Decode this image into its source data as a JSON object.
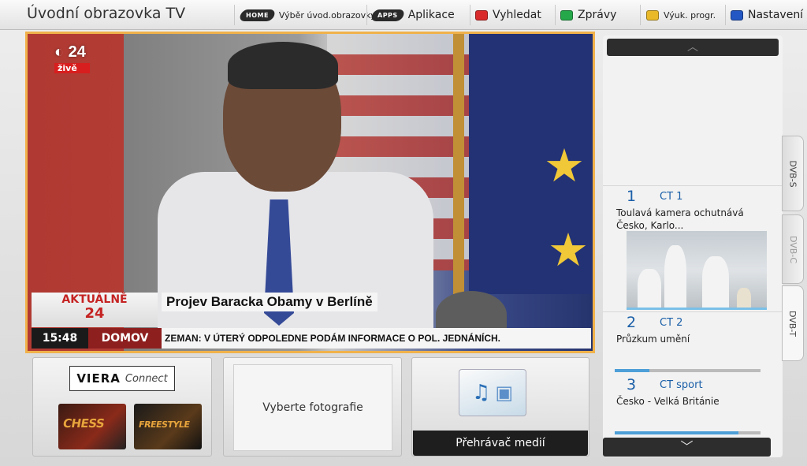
{
  "header": {
    "title": "Úvodní obrazovka TV",
    "home_badge": "HOME",
    "home_label": "Výběr úvod.obrazovky",
    "apps_badge": "APPS",
    "apps_label": "Aplikace",
    "search_label": "Vyhledat",
    "news_label": "Zprávy",
    "guide_label": "Výuk. progr.",
    "settings_label": "Nastavení"
  },
  "colors": {
    "accent_frame": "#f1b24b",
    "red_key": "#d92b2b",
    "green_key": "#25a84a",
    "yellow_key": "#e9b92a",
    "blue_key": "#2357c3",
    "channel_blue": "#1a5fa8"
  },
  "tv": {
    "channel_logo": "24",
    "live_label": "živě",
    "aktualne_line1": "AKTUÁLNĚ",
    "aktualne_line2": "24",
    "headline": "Projev Baracka Obamy v Berlíně",
    "clock": "15:48",
    "section": "DOMOV",
    "ticker": "ZEMAN: V ÚTERÝ ODPOLEDNE PODÁM INFORMACE O POL. JEDNÁNÍCH."
  },
  "channels": [
    {
      "number": "1",
      "name": "CT 1",
      "program": "Toulavá kamera ochutnává Česko, Karlo..."
    },
    {
      "number": "2",
      "name": "CT 2",
      "program": "Průzkum umění",
      "progress": 0.24
    },
    {
      "number": "3",
      "name": "CT sport",
      "program": "Česko - Velká Británie",
      "progress": 0.85
    }
  ],
  "tabs": [
    "DVB-S",
    "DVB-C",
    "DVB-T"
  ],
  "tiles": {
    "viera_logo": "VIERA",
    "viera_connect": "Connect",
    "app1": "CHESS",
    "app2": "FREESTYLE",
    "photos": "Vyberte fotografie",
    "media": "Přehrávač medií"
  },
  "icons": {
    "scroll_up": "chevron-up-icon",
    "scroll_down": "chevron-down-icon",
    "media": "music-photo-icon"
  }
}
